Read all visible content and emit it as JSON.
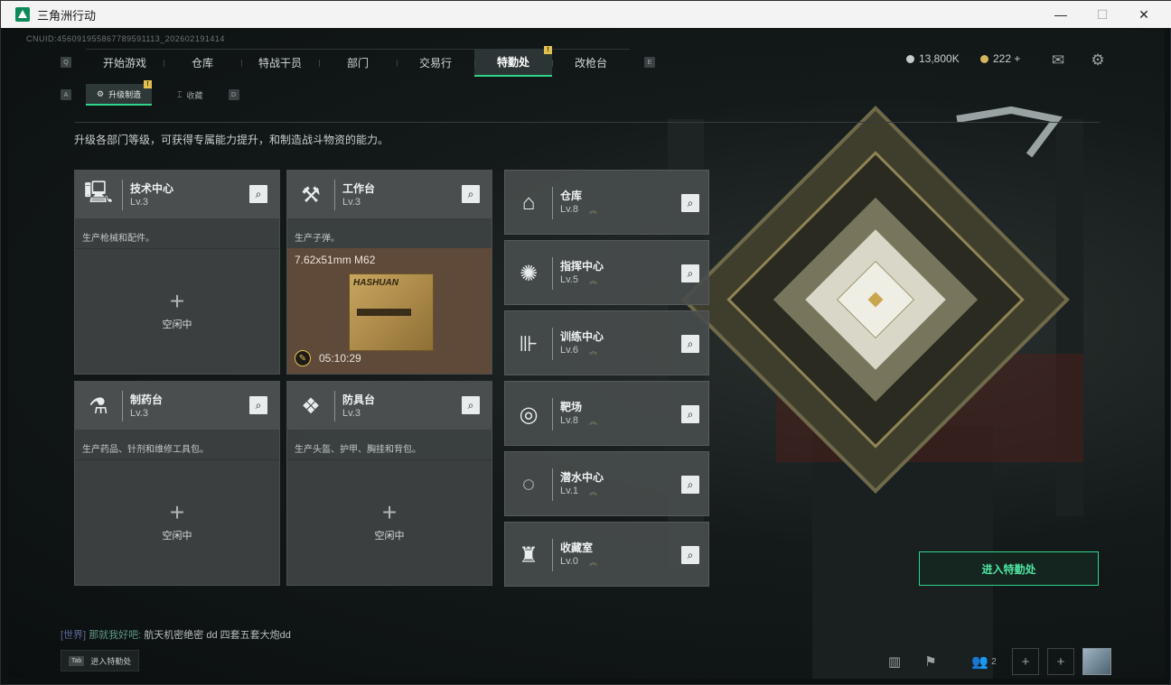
{
  "window": {
    "title": "三角洲行动",
    "minimize": "—",
    "maximize": "☐",
    "close": "✕"
  },
  "uid": "CNUID:456091955867789591113_202602191414",
  "nav": {
    "left_key": "Q",
    "right_key": "E",
    "tabs": [
      "开始游戏",
      "仓库",
      "特战干员",
      "部门",
      "交易行",
      "特勤处",
      "改枪台"
    ],
    "active_tab": "特勤处",
    "badge": "!"
  },
  "subnav": {
    "left_key": "A",
    "right_key": "D",
    "tabs": [
      {
        "label": "升级制造",
        "icon": "⚙"
      },
      {
        "label": "收藏",
        "icon": "⌶"
      }
    ],
    "badge": "!"
  },
  "currency": {
    "silver": "13,800K",
    "gold": "222 +"
  },
  "description": "升级各部门等级，可获得专属能力提升，和制造战斗物资的能力。",
  "left_cards": [
    {
      "name": "技术中心",
      "level": "Lv.3",
      "icon": "computer-icon",
      "glyph": "🖳",
      "subtitle": "生产枪械和配件。",
      "status": "空闲中"
    },
    {
      "name": "工作台",
      "level": "Lv.3",
      "icon": "tools-icon",
      "glyph": "⚒",
      "subtitle": "生产子弹。",
      "product": "7.62x51mm M62",
      "box_label": "HASHUAN",
      "timer": "05:10:29"
    },
    {
      "name": "制药台",
      "level": "Lv.3",
      "icon": "microscope-icon",
      "glyph": "⚗",
      "subtitle": "生产药品、针剂和维修工具包。",
      "status": "空闲中"
    },
    {
      "name": "防具台",
      "level": "Lv.3",
      "icon": "cubes-icon",
      "glyph": "❖",
      "subtitle": "生产头盔、护甲、胸挂和背包。",
      "status": "空闲中"
    }
  ],
  "right_cards": [
    {
      "name": "仓库",
      "level": "Lv.8",
      "icon": "warehouse-icon",
      "glyph": "⌂"
    },
    {
      "name": "指挥中心",
      "level": "Lv.5",
      "icon": "command-icon",
      "glyph": "✺"
    },
    {
      "name": "训练中心",
      "level": "Lv.6",
      "icon": "dumbbell-icon",
      "glyph": "⊪"
    },
    {
      "name": "靶场",
      "level": "Lv.8",
      "icon": "target-icon",
      "glyph": "◎"
    },
    {
      "name": "潜水中心",
      "level": "Lv.1",
      "icon": "goggles-icon",
      "glyph": "◌"
    },
    {
      "name": "收藏室",
      "level": "Lv.0",
      "icon": "trophy-icon",
      "glyph": "♜"
    }
  ],
  "upgrade_glyph": "︽",
  "plus_glyph": "+",
  "enter_button": "进入特勤处",
  "chat": {
    "channel": "[世界]",
    "name": "那就我好吧:",
    "message": "航天机密绝密 dd  四套五套大炮dd"
  },
  "tab_hint": {
    "key": "Tab",
    "label": "进入特勤处"
  },
  "bottom": {
    "squad_count": "2"
  }
}
